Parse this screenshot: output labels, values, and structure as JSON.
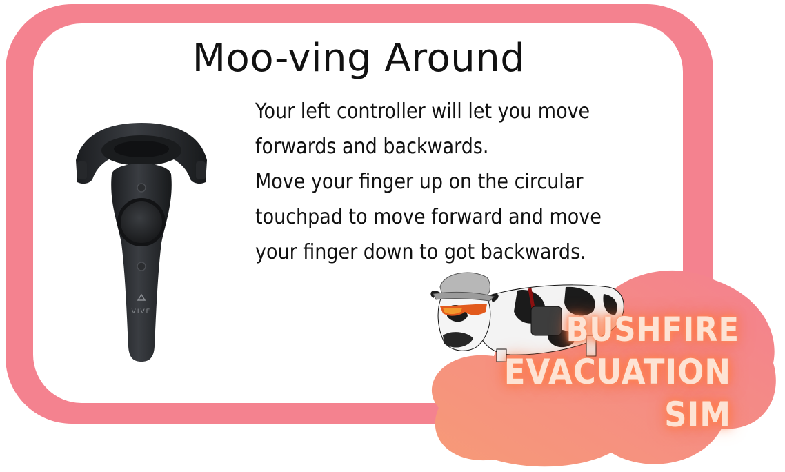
{
  "title": "Moo-ving Around",
  "instructions": [
    "Your left controller will let you move",
    "forwards and backwards.",
    "Move your finger up on the circular",
    "touchpad to move forward and move",
    "your finger down to got backwards."
  ],
  "controller": {
    "brand_text": "VIVE",
    "icon": "vr-controller-icon"
  },
  "logo": {
    "line1": "BUSHFIRE",
    "line2": "EVACUATION SIM"
  },
  "mascot": {
    "icon": "cow-mascot-icon"
  },
  "colors": {
    "frame": "#f4828f",
    "blob": "#f5897f",
    "logo_glow": "#ff7a45"
  }
}
